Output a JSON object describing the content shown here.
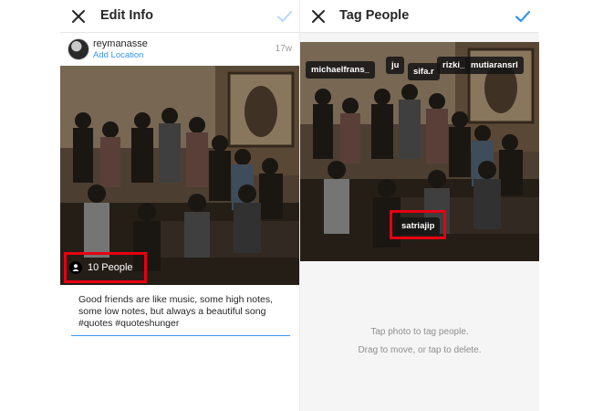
{
  "edit_info": {
    "title": "Edit Info",
    "user": {
      "username": "reymanasse",
      "add_location": "Add Location",
      "time_ago": "17w"
    },
    "people_count_label": "10 People",
    "caption": "Good friends are like music, some high notes, some low notes, but always a beautiful song #quotes #quoteshunger"
  },
  "tag_people": {
    "title": "Tag People",
    "tags": [
      "michaelfrans_",
      "ju",
      "sifa.r",
      "rizki_",
      "mutiaransrl",
      "satriajip"
    ],
    "hint_line1": "Tap photo to tag people.",
    "hint_line2": "Drag to move, or tap to delete."
  },
  "colors": {
    "accent": "#3897f0",
    "highlight": "#e60012",
    "tag_bg": "#141414"
  },
  "icons": [
    "close-icon",
    "check-icon",
    "person-icon"
  ]
}
